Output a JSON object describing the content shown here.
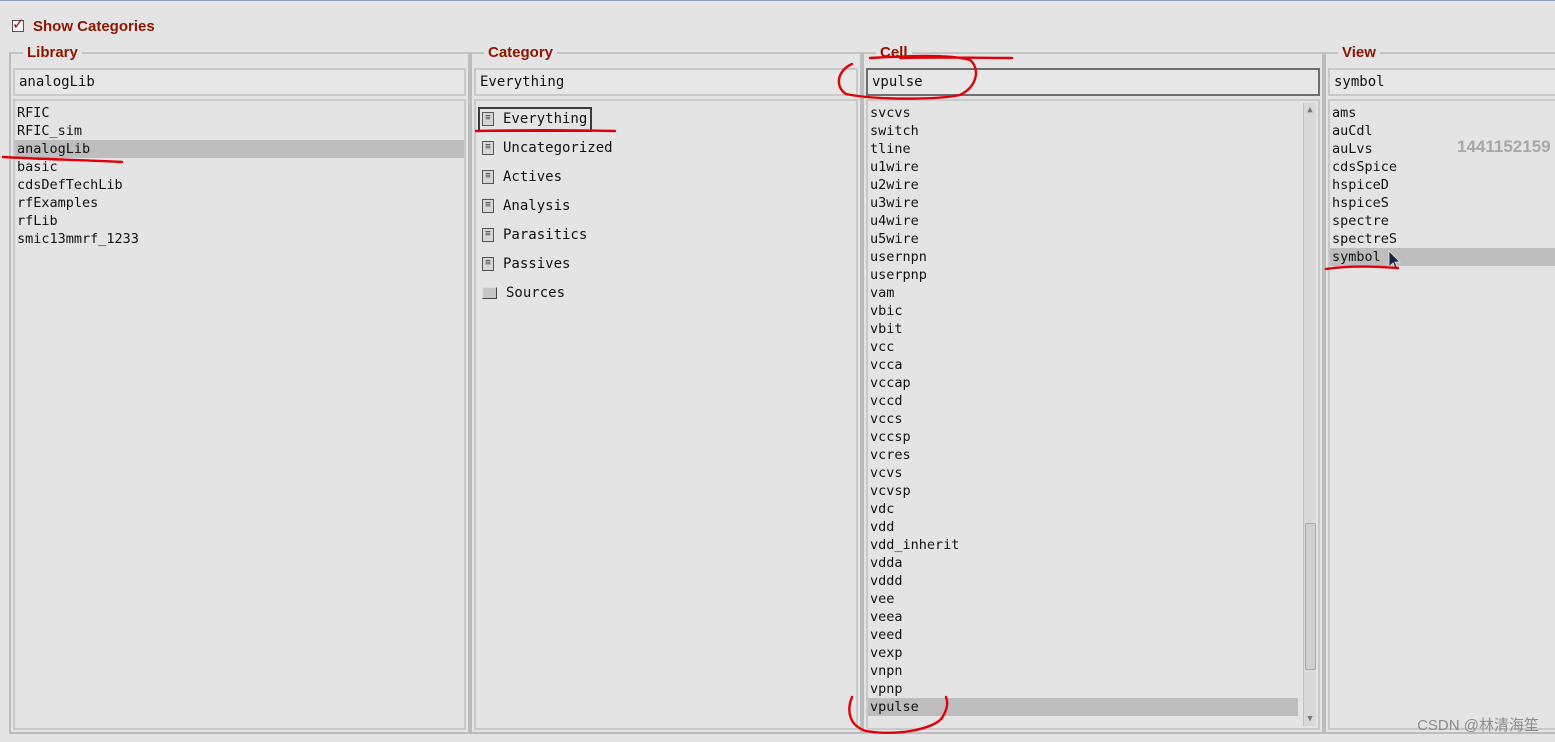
{
  "show_categories": {
    "label": "Show Categories",
    "checked": true
  },
  "library": {
    "title": "Library",
    "value": "analogLib",
    "items": [
      "RFIC",
      "RFIC_sim",
      "analogLib",
      "basic",
      "cdsDefTechLib",
      "rfExamples",
      "rfLib",
      "smic13mmrf_1233"
    ],
    "selected_index": 2
  },
  "category": {
    "title": "Category",
    "value": "Everything",
    "items": [
      {
        "label": "Everything",
        "icon": "document-icon"
      },
      {
        "label": "Uncategorized",
        "icon": "document-icon"
      },
      {
        "label": "Actives",
        "icon": "document-icon"
      },
      {
        "label": "Analysis",
        "icon": "document-icon"
      },
      {
        "label": "Parasitics",
        "icon": "document-icon"
      },
      {
        "label": "Passives",
        "icon": "document-icon"
      },
      {
        "label": "Sources",
        "icon": "folder-icon"
      }
    ],
    "selected_index": 0
  },
  "cell": {
    "title": "Cell",
    "value": "vpulse",
    "items": [
      "svcvs",
      "switch",
      "tline",
      "u1wire",
      "u2wire",
      "u3wire",
      "u4wire",
      "u5wire",
      "usernpn",
      "userpnp",
      "vam",
      "vbic",
      "vbit",
      "vcc",
      "vcca",
      "vccap",
      "vccd",
      "vccs",
      "vccsp",
      "vcres",
      "vcvs",
      "vcvsp",
      "vdc",
      "vdd",
      "vdd_inherit",
      "vdda",
      "vddd",
      "vee",
      "veea",
      "veed",
      "vexp",
      "vnpn",
      "vpnp",
      "vpulse"
    ],
    "selected_index": 33
  },
  "view": {
    "title": "View",
    "value": "symbol",
    "items": [
      "ams",
      "auCdl",
      "auLvs",
      "cdsSpice",
      "hspiceD",
      "hspiceS",
      "spectre",
      "spectreS",
      "symbol"
    ],
    "selected_index": 8
  },
  "overlay": {
    "watermark": "1441152159",
    "credit": "CSDN @林清海笙"
  },
  "colors": {
    "legend": "#8b1500",
    "annotation": "#e0000a",
    "selection": "#bdbdbd"
  }
}
